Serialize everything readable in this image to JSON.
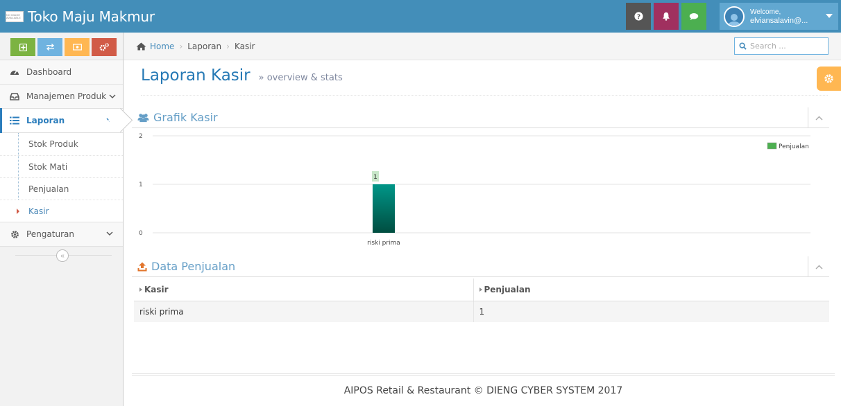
{
  "app": {
    "brand_name": "Toko Maju Makmur",
    "brand_logo_text": "NO IMAGE AVAILABLE"
  },
  "navbar": {
    "help_icon": "question-circle-icon",
    "bell_icon": "bell-icon",
    "chat_icon": "comment-icon",
    "user": {
      "welcome": "Welcome,",
      "name": "elviansalavin@..."
    },
    "colors": {
      "bar": "#438eb9",
      "help": "#555555",
      "bell": "#a0305f",
      "chat": "#4caf50",
      "user": "#62a8d1"
    }
  },
  "sidebar": {
    "shortcuts": [
      {
        "icon": "plus-square-icon",
        "color": "#7cb342"
      },
      {
        "icon": "exchange-icon",
        "color": "#6fb3e0"
      },
      {
        "icon": "money-icon",
        "color": "#ffb752"
      },
      {
        "icon": "cogs-icon",
        "color": "#d15b47"
      }
    ],
    "items": [
      {
        "label": "Dashboard",
        "icon": "tachometer-icon"
      },
      {
        "label": "Manajemen Produk",
        "icon": "inbox-icon"
      },
      {
        "label": "Laporan",
        "icon": "list-icon",
        "active": true
      },
      {
        "label": "Pengaturan",
        "icon": "cog-icon"
      }
    ],
    "submenu": [
      {
        "label": "Stok Produk"
      },
      {
        "label": "Stok Mati"
      },
      {
        "label": "Penjualan"
      },
      {
        "label": "Kasir",
        "current": true
      }
    ],
    "collapse_symbol": "«"
  },
  "breadcrumbs": {
    "home": "Home",
    "items": [
      "Laporan",
      "Kasir"
    ],
    "separator": "›"
  },
  "search": {
    "placeholder": "Search ..."
  },
  "page": {
    "title": "Laporan Kasir",
    "subtitle": "» overview & stats"
  },
  "widgets": {
    "chart": {
      "title": "Grafik Kasir",
      "icon": "users-icon"
    },
    "table": {
      "title": "Data Penjualan",
      "icon": "upload-icon"
    }
  },
  "chart_data": {
    "type": "bar",
    "categories": [
      "riski prima"
    ],
    "series": [
      {
        "name": "Penjualan",
        "values": [
          1
        ]
      }
    ],
    "ylim": [
      0,
      2
    ],
    "yticks": [
      "0",
      "1",
      "2"
    ],
    "data_labels": [
      "1"
    ],
    "legend": "top-right",
    "grid": true,
    "colors": {
      "bar_top": "#009688",
      "bar_bottom": "#004d40",
      "legend": "#4caf50",
      "label_bg": "#c8e6c9"
    }
  },
  "table": {
    "columns": [
      "Kasir",
      "Penjualan"
    ],
    "rows": [
      [
        "riski prima",
        "1"
      ]
    ]
  },
  "footer": {
    "text": "AIPOS Retail & Restaurant © DIENG CYBER SYSTEM 2017"
  }
}
